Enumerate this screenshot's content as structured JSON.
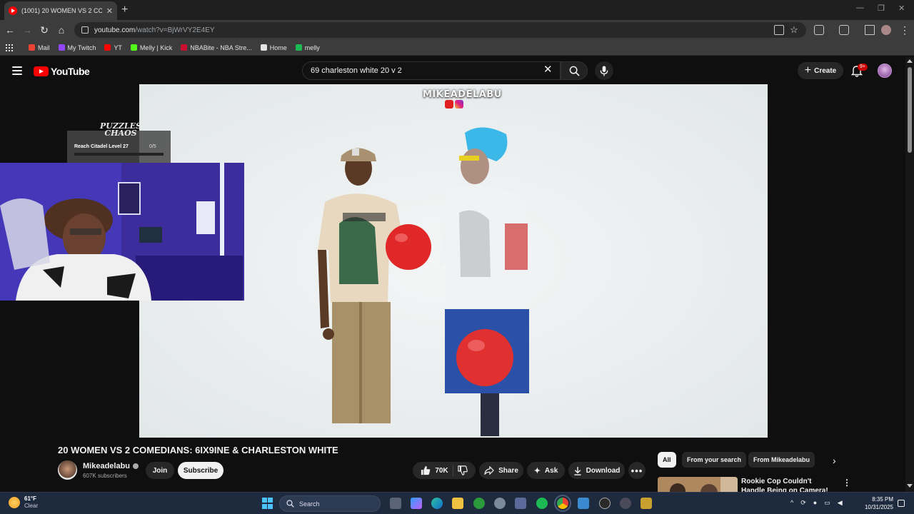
{
  "browser": {
    "tab_title": "(1001) 20 WOMEN VS 2 COMEDIANS: 6IX9INE & CHARLESTON WHITE",
    "url_host": "youtube.com",
    "url_path": "/watch?v=BjWrVY2E4EY",
    "bookmarks": [
      {
        "label": "Mail",
        "color": "#ea4335"
      },
      {
        "label": "My Twitch",
        "color": "#9146ff"
      },
      {
        "label": "YT",
        "color": "#ff0000"
      },
      {
        "label": "Melly | Kick",
        "color": "#53fc18"
      },
      {
        "label": "NBABite - NBA Stre...",
        "color": "#c8102e"
      },
      {
        "label": "Home",
        "color": "#e3e3e3"
      },
      {
        "label": "melly",
        "color": "#1db954"
      }
    ]
  },
  "youtube": {
    "logo_text": "YouTube",
    "search_query": "69 charleston white 20 v 2",
    "create_label": "Create",
    "notification_badge": "9+",
    "video": {
      "watermark": "MIKEADELABU",
      "title": "20 WOMEN VS 2 COMEDIANS: 6IX9INE & CHARLESTON WHITE",
      "channel": "Mikeadelabu",
      "subscribers": "607K subscribers",
      "join_label": "Join",
      "subscribe_label": "Subscribe",
      "likes": "70K",
      "share_label": "Share",
      "ask_label": "Ask",
      "download_label": "Download"
    },
    "chips": [
      "All",
      "From your search",
      "From Mikeadelabu"
    ],
    "recommended": {
      "title": "Rookie Cop Couldn't Handle Being on Camera!"
    }
  },
  "overlay": {
    "achievement_game": "PUZZLES CHAOS",
    "achievement_text": "Reach Citadel Level 27",
    "achievement_count": "0/5"
  },
  "taskbar": {
    "temperature": "61°F",
    "condition": "Clear",
    "search_placeholder": "Search",
    "time": "8:35 PM",
    "date": "10/31/2025"
  }
}
